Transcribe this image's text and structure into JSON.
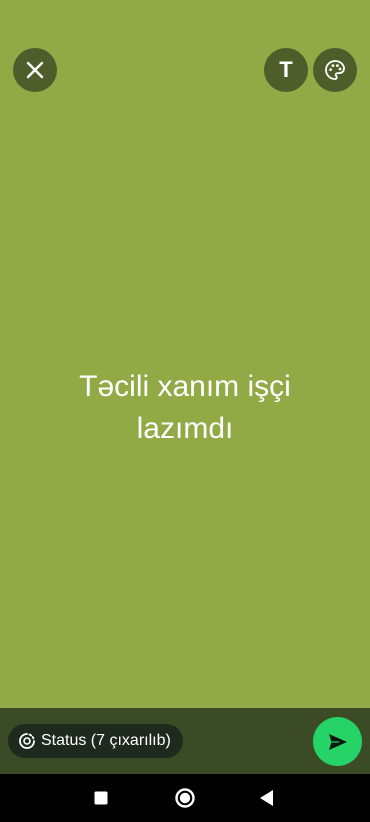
{
  "top_bar": {
    "close_icon": "close-icon",
    "text_tool_label": "T",
    "palette_icon": "palette-icon"
  },
  "status": {
    "text": "Təcili xanım işçi lazımdı",
    "background_color": "#91aa46"
  },
  "bottom_bar": {
    "audience_icon": "status-ring-icon",
    "audience_label": "Status (7 çıxarılıb)",
    "send_icon": "send-icon",
    "send_color": "#25d366"
  },
  "navigation": {
    "recents_icon": "recents-square-icon",
    "home_icon": "home-circle-icon",
    "back_icon": "back-triangle-icon"
  }
}
